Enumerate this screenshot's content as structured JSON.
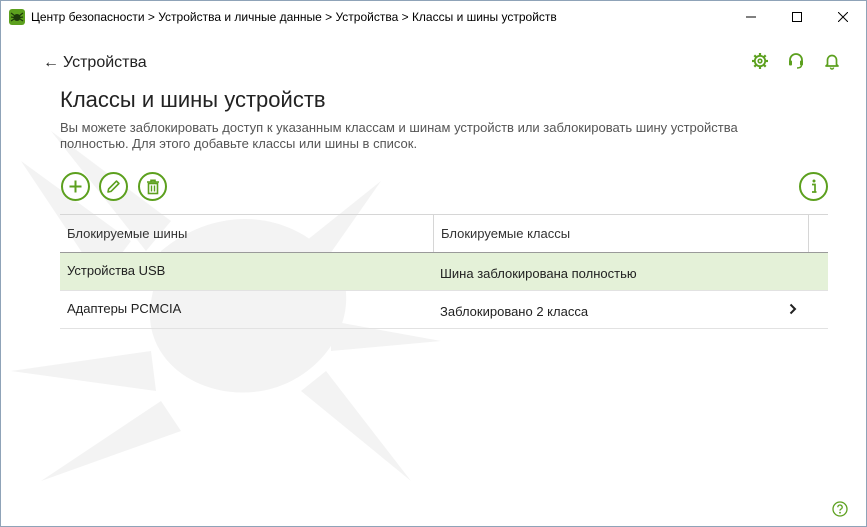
{
  "window": {
    "title": "Центр безопасности > Устройства и личные данные > Устройства > Классы и шины устройств",
    "brand_color": "#5ca01e"
  },
  "header": {
    "back_label": "Устройства",
    "back_arrow": "←",
    "icons": [
      "settings-icon",
      "support-icon",
      "notifications-icon"
    ]
  },
  "main": {
    "title": "Классы и шины устройств",
    "description": "Вы можете заблокировать доступ к указанным классам и шинам устройств или заблокировать шину устройства полностью. Для этого добавьте классы или шины в список.",
    "toolbar": [
      "add-icon",
      "edit-icon",
      "delete-icon",
      "info-icon"
    ]
  },
  "table": {
    "columns": [
      "Блокируемые шины",
      "Блокируемые классы"
    ],
    "rows": [
      {
        "bus": "Устройства USB",
        "classes": "Шина заблокирована полностью",
        "selected": true
      },
      {
        "bus": "Адаптеры PCMCIA",
        "classes": "Заблокировано 2 класса",
        "selected": false
      }
    ]
  }
}
